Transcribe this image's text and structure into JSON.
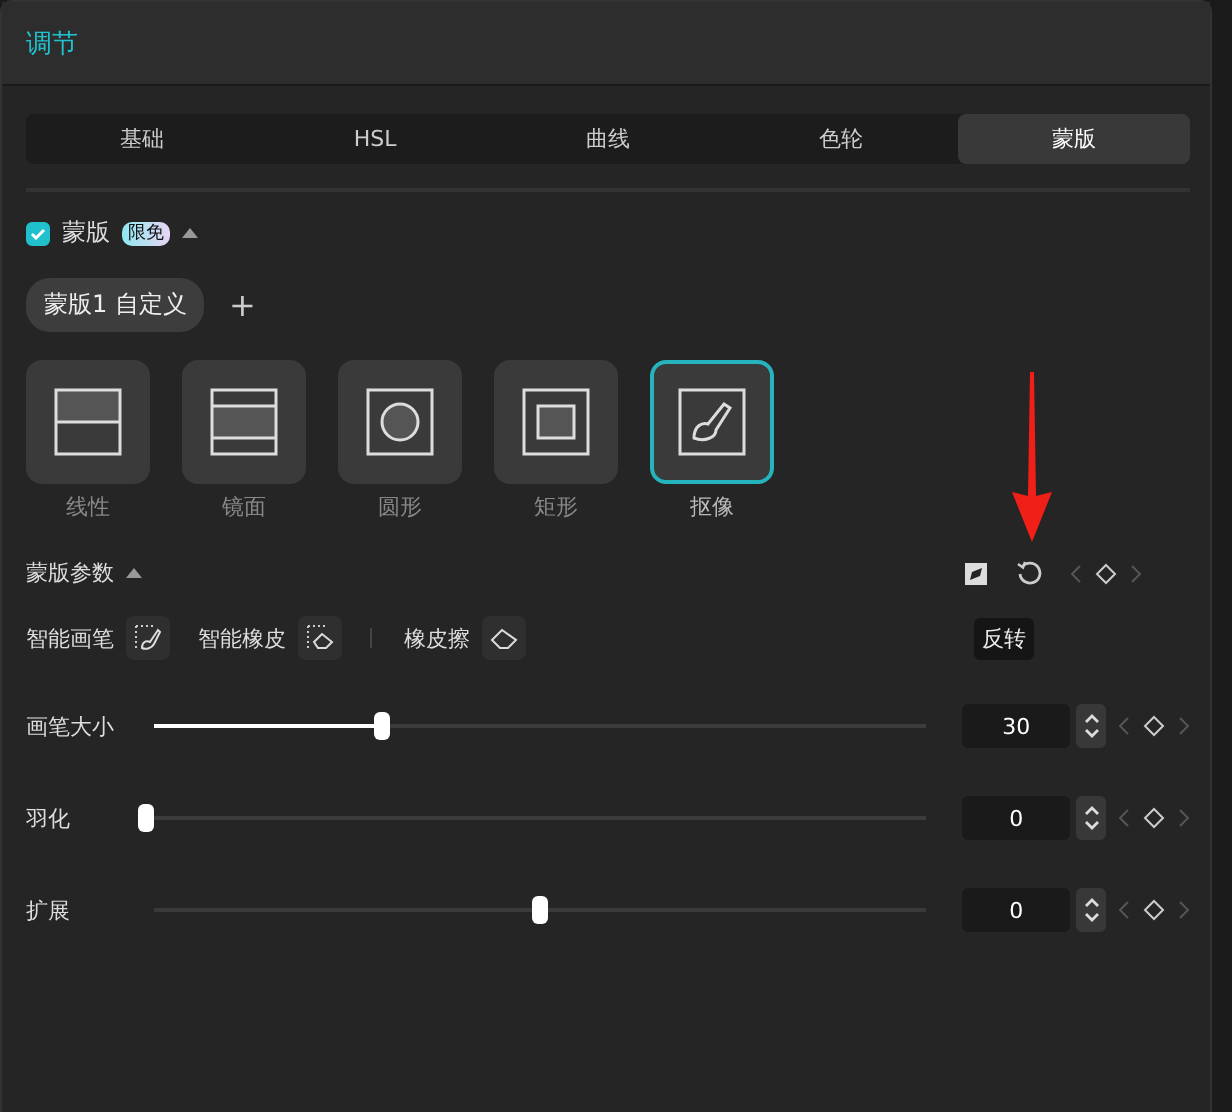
{
  "panel": {
    "title": "调节"
  },
  "tabs": [
    {
      "label": "基础",
      "selected": false
    },
    {
      "label": "HSL",
      "selected": false
    },
    {
      "label": "曲线",
      "selected": false
    },
    {
      "label": "色轮",
      "selected": false
    },
    {
      "label": "蒙版",
      "selected": true
    }
  ],
  "mask_toggle": {
    "label": "蒙版",
    "checked": true,
    "badge": "限免",
    "expanded": true
  },
  "mask_chip": {
    "label": "蒙版1 自定义",
    "add": "+"
  },
  "mask_types": [
    {
      "kind": "linear",
      "label": "线性",
      "selected": false
    },
    {
      "kind": "mirror",
      "label": "镜面",
      "selected": false
    },
    {
      "kind": "circle",
      "label": "圆形",
      "selected": false
    },
    {
      "kind": "rect",
      "label": "矩形",
      "selected": false
    },
    {
      "kind": "cutout",
      "label": "抠像",
      "selected": true
    }
  ],
  "params": {
    "title": "蒙版参数",
    "expanded": true,
    "tooltip": "反转"
  },
  "tools": [
    {
      "kind": "brush",
      "label": "智能画笔"
    },
    {
      "kind": "smart_eraser",
      "label": "智能橡皮"
    },
    {
      "kind": "eraser",
      "label": "橡皮擦"
    }
  ],
  "sliders": [
    {
      "label": "画笔大小",
      "level": 0.3,
      "bipolar": false,
      "value": "30"
    },
    {
      "label": "羽化",
      "level": 0,
      "bipolar": false,
      "value": "0"
    },
    {
      "label": "扩展",
      "level": 0.5,
      "bipolar": true,
      "value": "0"
    }
  ]
}
